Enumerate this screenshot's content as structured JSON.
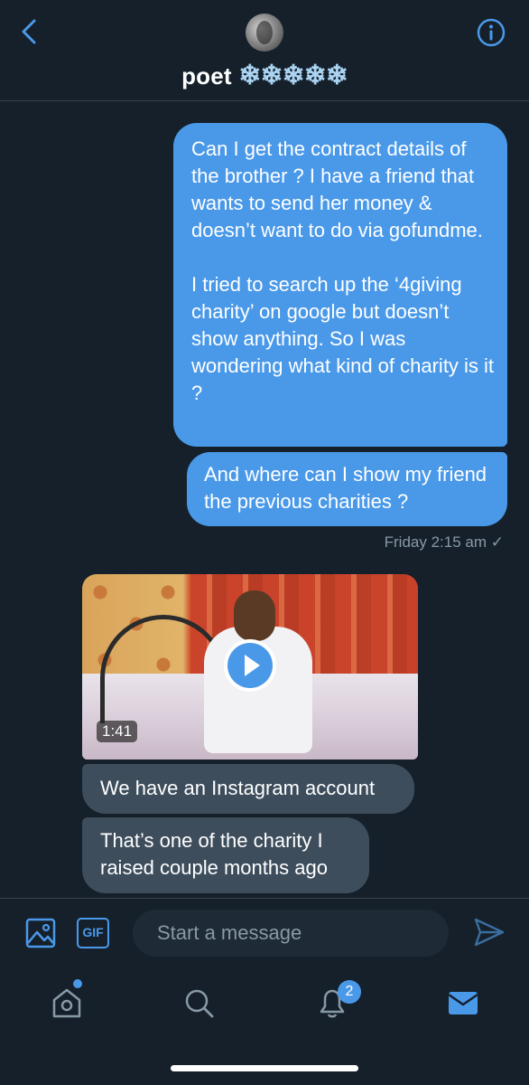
{
  "header": {
    "name": "poet",
    "snowflakes": "❄❄❄❄❄",
    "back_icon": "chevron-left-icon",
    "info_icon": "info-icon"
  },
  "messages": {
    "sent_1": "Can I get the contract details of the brother ? I have a friend that wants to send her money & doesn’t want to do via gofundme.\n\nI tried to search up the ‘4giving charity’ on google but doesn’t show anything. So I was wondering what kind of charity is it ?",
    "sent_2": "And where can I show my friend the previous charities ?",
    "timestamp": "Friday 2:15 am ✓",
    "video_duration": "1:41",
    "received_1": "We have an Instagram account",
    "received_2": "That’s one of the charity I raised couple months ago"
  },
  "composer": {
    "placeholder": "Start a message",
    "gif_label": "GIF"
  },
  "tabs": {
    "notifications_badge": "2"
  },
  "colors": {
    "background": "#15202b",
    "accent": "#4a99e9",
    "received_bubble": "#3d4d5c",
    "muted_text": "#8899a6"
  }
}
